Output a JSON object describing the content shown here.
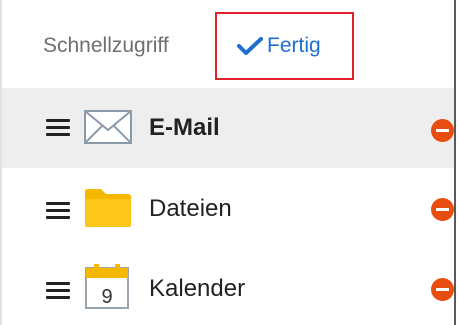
{
  "header": {
    "title": "Schnellzugriff",
    "done_label": "Fertig",
    "done_icon": "checkmark-icon"
  },
  "colors": {
    "accent_blue": "#1e6fd0",
    "highlight_red": "#e0202a",
    "remove_orange": "#e84c0e",
    "folder_yellow": "#f5b700",
    "selected_row_bg": "#eeeeee"
  },
  "items": [
    {
      "label": "E-Mail",
      "icon": "envelope-icon",
      "selected": true
    },
    {
      "label": "Dateien",
      "icon": "folder-icon",
      "selected": false
    },
    {
      "label": "Kalender",
      "icon": "calendar-icon",
      "selected": false,
      "icon_text": "9"
    }
  ]
}
